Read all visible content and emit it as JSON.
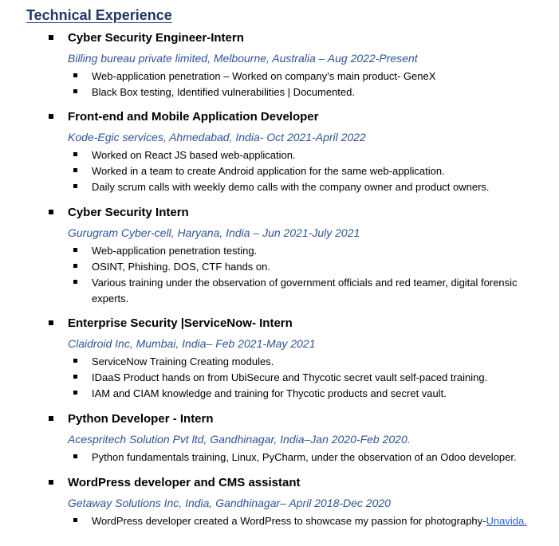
{
  "section": {
    "title": "Technical Experience"
  },
  "jobs": [
    {
      "title": "Cyber Security Engineer-Intern",
      "meta": "Billing bureau private limited, Melbourne, Australia – Aug 2022-Present",
      "bullets": [
        "Web-application penetration – Worked on company’s main product- GeneX",
        "Black Box testing, Identified vulnerabilities | Documented."
      ]
    },
    {
      "title": "Front-end and Mobile Application Developer",
      "meta": "Kode-Egic services, Ahmedabad, India- Oct 2021-April 2022",
      "bullets": [
        "Worked on React JS based web-application.",
        "Worked in a team to create Android application for the same web-application.",
        "Daily scrum calls with weekly demo calls with the company owner and product owners."
      ]
    },
    {
      "title": "Cyber Security Intern",
      "meta": "Gurugram Cyber-cell, Haryana, India – Jun 2021-July 2021",
      "bullets": [
        "Web-application penetration testing.",
        "OSINT, Phishing. DOS, CTF hands on.",
        "Various training under the observation of government officials and red teamer, digital forensic experts."
      ]
    },
    {
      "title": "Enterprise Security |ServiceNow- Intern",
      "meta": "Claidroid Inc, Mumbai, India– Feb 2021-May 2021",
      "bullets": [
        "ServiceNow Training Creating modules.",
        "IDaaS Product hands on from UbiSecure and Thycotic secret vault self-paced training.",
        "IAM and CIAM knowledge and training for Thycotic products and secret vault."
      ]
    },
    {
      "title": "Python Developer - Intern",
      "meta": "Acespritech Solution Pvt ltd, Gandhinagar, India–Jan 2020-Feb 2020.",
      "bullets": [
        "Python fundamentals training, Linux, PyCharm, under the observation of an Odoo developer."
      ]
    },
    {
      "title": "WordPress developer and CMS assistant",
      "meta": "Getaway Solutions Inc, India, Gandhinagar– April 2018-Dec 2020",
      "bullets": [
        "WordPress developer created a WordPress to showcase my passion for photography-"
      ],
      "link_text": "Unavida."
    }
  ]
}
